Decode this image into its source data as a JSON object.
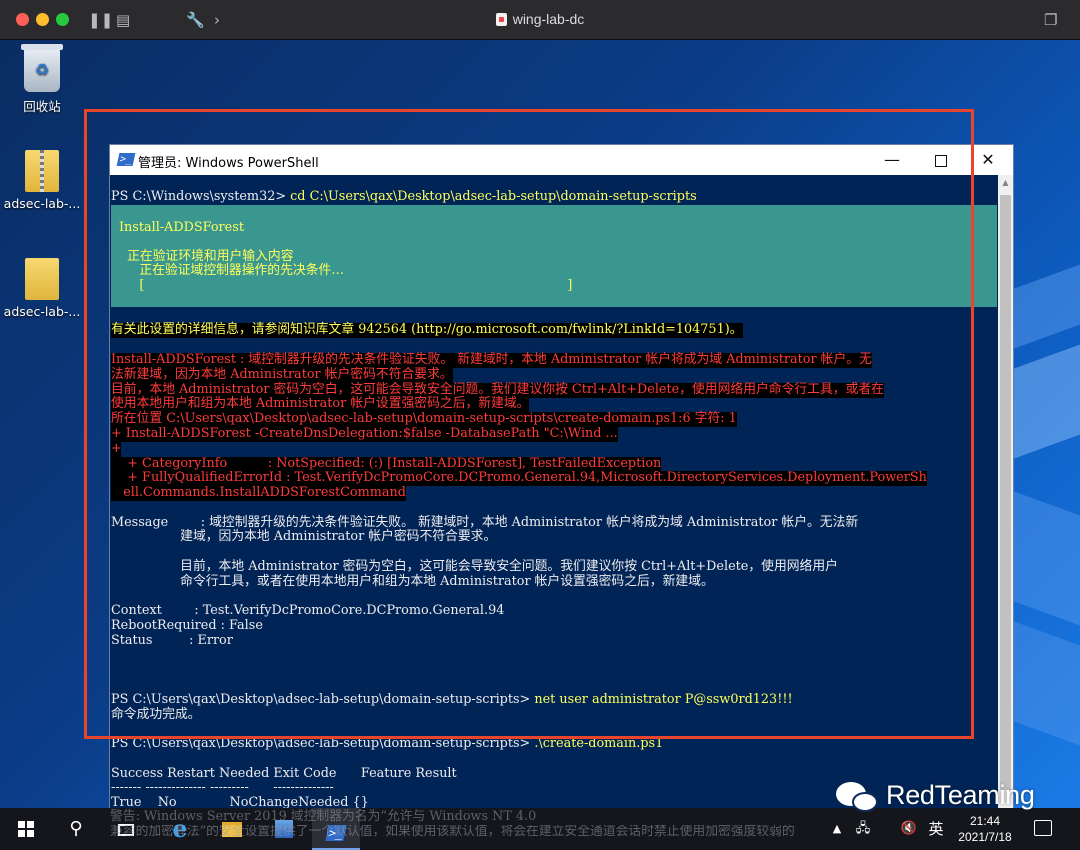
{
  "host": {
    "title": "wing-lab-dc"
  },
  "desktop": {
    "icons": [
      {
        "label": "回收站",
        "icon": "recycle-bin-icon"
      },
      {
        "label": "adsec-lab-...",
        "icon": "zip-folder-icon"
      },
      {
        "label": "adsec-lab-...",
        "icon": "folder-icon"
      }
    ]
  },
  "powershell": {
    "title": "管理员: Windows PowerShell",
    "buttons": {
      "minimize": "—",
      "close": "✕"
    },
    "lines": {
      "l1": "PS C:\\Windows\\system32> ",
      "l1_cmd": "cd C:\\Users\\qax\\Desktop\\adsec-lab-setup\\domain-setup-scripts",
      "p1": "Install-ADDSForest",
      "p2": "  正在验证环境和用户输入内容",
      "p3": "     正在验证域控制器操作的先决条件…",
      "p4": "     [                                                                                                        ]",
      "w1": "有关此设置的详细信息，请参阅知识库文章 942564 (http://go.microsoft.com/fwlink/?LinkId=104751)。",
      "e1": "Install-ADDSForest : 域控制器升级的先决条件验证失败。 新建域时，本地 Administrator 帐户将成为域 Administrator 帐户。无",
      "e2": "法新建域，因为本地 Administrator 帐户密码不符合要求。",
      "e3": "目前，本地 Administrator 密码为空白，这可能会导致安全问题。我们建议你按 Ctrl+Alt+Delete，使用网络用户命令行工具，或者在",
      "e4": "使用本地用户和组为本地 Administrator 帐户设置强密码之后，新建域。",
      "e5": "所在位置 C:\\Users\\qax\\Desktop\\adsec-lab-setup\\domain-setup-scripts\\create-domain.ps1:6 字符: 1",
      "e6": "+ Install-ADDSForest -CreateDnsDelegation:$false -DatabasePath \"C:\\Wind ...",
      "e7": "+ ~~~~~~~~~~~~~~~~~~~~~~~~~~~~~~~~~~~~~~~~~~~~~~~~~~~~~~~~~~~~~~~~~~~~~~~~~~~~~",
      "e8": "    + CategoryInfo          : NotSpecified: (:) [Install-ADDSForest], TestFailedException",
      "e9": "    + FullyQualifiedErrorId : Test.VerifyDcPromoCore.DCPromo.General.94,Microsoft.DirectoryServices.Deployment.PowerSh",
      "e10": "   ell.Commands.InstallADDSForestCommand",
      "m1": "Message        : 域控制器升级的先决条件验证失败。 新建域时，本地 Administrator 帐户将成为域 Administrator 帐户。无法新",
      "m2": "                 建域，因为本地 Administrator 帐户密码不符合要求。",
      "m3": "                 目前，本地 Administrator 密码为空白，这可能会导致安全问题。我们建议你按 Ctrl+Alt+Delete，使用网络用户",
      "m4": "                 命令行工具，或者在使用本地用户和组为本地 Administrator 帐户设置强密码之后，新建域。",
      "c1": "Context        : Test.VerifyDcPromoCore.DCPromo.General.94",
      "c2": "RebootRequired : False",
      "c3": "Status         : Error",
      "n1": "PS C:\\Users\\qax\\Desktop\\adsec-lab-setup\\domain-setup-scripts> ",
      "n1_cmd": "net user administrator P@ssw0rd123!!!",
      "n2": "命令成功完成。",
      "s1": "PS C:\\Users\\qax\\Desktop\\adsec-lab-setup\\domain-setup-scripts> ",
      "s1_cmd": ".\\create-domain.ps1",
      "t1": "Success Restart Needed Exit Code      Feature Result",
      "t2": "------- -------------- ---------      --------------",
      "t3": "True    No             NoChangeNeeded {}"
    }
  },
  "taskbar": {
    "overlay1": "警告: Windows Server 2019 域控制器为名为“允许与 Windows NT 4.0",
    "overlay2": "兼容的加密算法”的安全设置提供了一个默认值，如果使用该默认值，将会在建立安全通道会话时禁止使用加密强度较弱的",
    "language": "英",
    "time": "21:44",
    "date": "2021/7/18"
  },
  "watermark": {
    "text": "RedTeaming"
  }
}
